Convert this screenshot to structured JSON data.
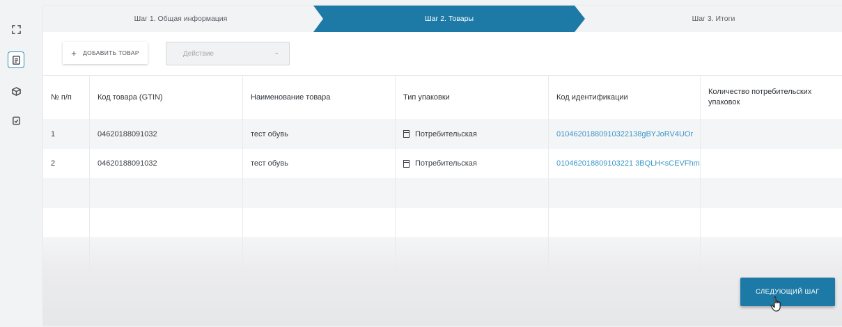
{
  "sidebar": {
    "items": [
      {
        "icon": "expand-icon",
        "active": false
      },
      {
        "icon": "document-icon",
        "active": true
      },
      {
        "icon": "package-icon",
        "active": false
      },
      {
        "icon": "checklist-icon",
        "active": false
      }
    ]
  },
  "stepper": {
    "steps": [
      {
        "label": "Шаг 1. Общая информация",
        "active": false
      },
      {
        "label": "Шаг 2. Товары",
        "active": true
      },
      {
        "label": "Шаг 3. Итоги",
        "active": false
      }
    ]
  },
  "toolbar": {
    "add_icon": "+",
    "add_label": "ДОБАВИТЬ ТОВАР",
    "action_placeholder": "Действие",
    "action_chevron": "⌄"
  },
  "table": {
    "columns": [
      "№ п/п",
      "Код товара (GTIN)",
      "Наименование товара",
      "Тип упаковки",
      "Код идентификации",
      "Количество потребительских упаковок"
    ],
    "rows": [
      {
        "num": "1",
        "gtin": "04620188091032",
        "name": "тест обувь",
        "pack": "Потребительская",
        "code": "01046201880910322138gBYJoRV4UOr",
        "qty": ""
      },
      {
        "num": "2",
        "gtin": "04620188091032",
        "name": "тест обувь",
        "pack": "Потребительская",
        "code": "010462018809103221 3BQLH<sCEVFhm",
        "qty": ""
      }
    ]
  },
  "footer": {
    "next_label": "СЛЕДУЮЩИЙ ШАГ"
  },
  "colors": {
    "accent": "#1d7aa6",
    "link": "#3a95c8"
  }
}
